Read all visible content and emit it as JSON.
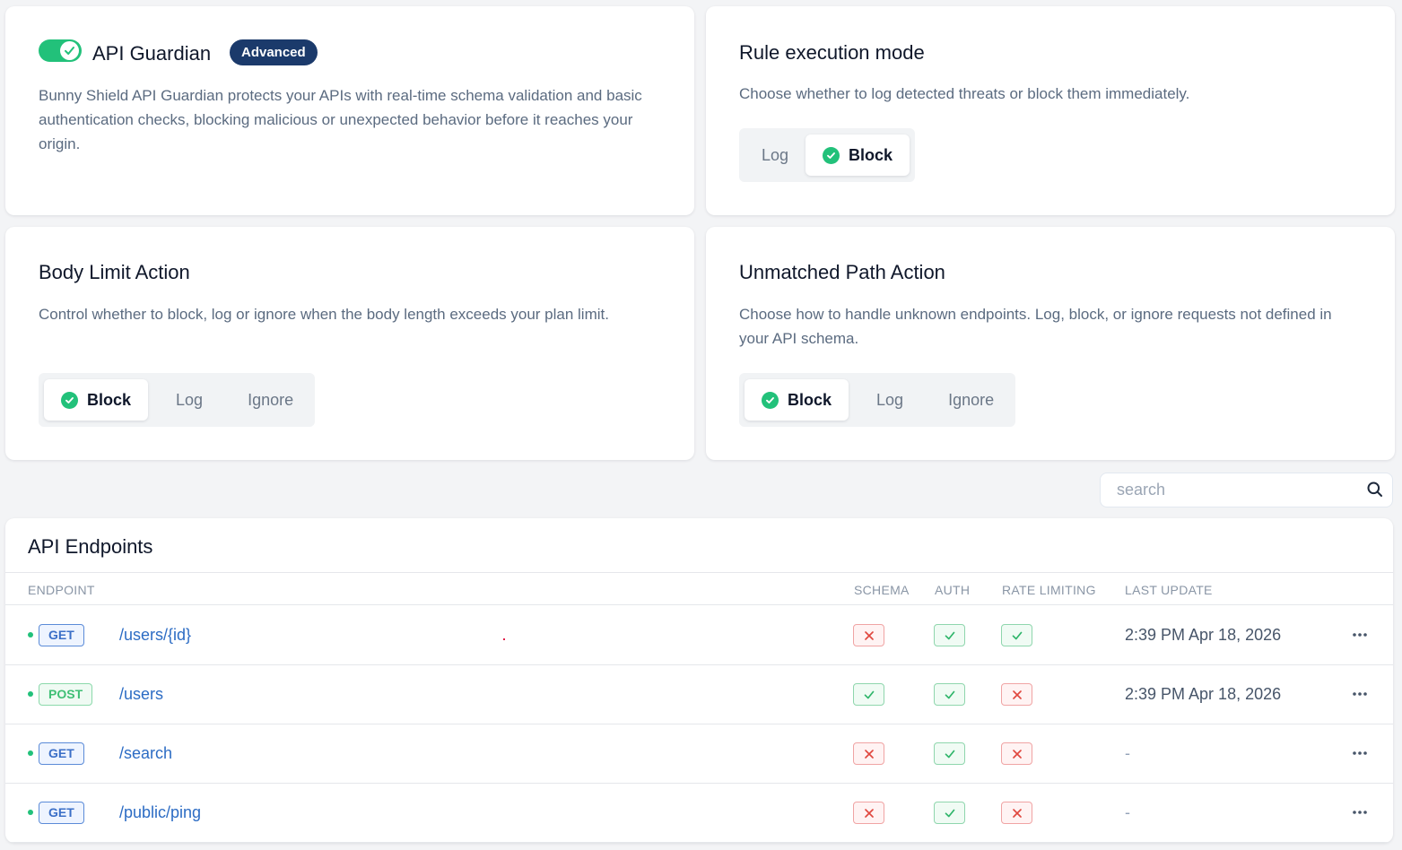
{
  "colors": {
    "accent_green": "#22c17a",
    "badge_navy": "#1b3a6b",
    "link_blue": "#2c6cc4",
    "error_red": "#e0483f"
  },
  "guardian": {
    "toggle_on": true,
    "title": "API Guardian",
    "badge": "Advanced",
    "description": "Bunny Shield API Guardian protects your APIs with real-time schema validation and basic authentication checks, blocking malicious or unexpected behavior before it reaches your origin."
  },
  "execution_mode": {
    "title": "Rule execution mode",
    "description": "Choose whether to log detected threats or block them immediately.",
    "options": [
      "Log",
      "Block"
    ],
    "selected": "Block"
  },
  "body_limit": {
    "title": "Body Limit Action",
    "description": "Control whether to block, log or ignore when the body length exceeds your plan limit.",
    "options": [
      "Block",
      "Log",
      "Ignore"
    ],
    "selected": "Block"
  },
  "unmatched_path": {
    "title": "Unmatched Path Action",
    "description": "Choose how to handle unknown endpoints. Log, block, or ignore requests not defined in your API schema.",
    "options": [
      "Block",
      "Log",
      "Ignore"
    ],
    "selected": "Block"
  },
  "search": {
    "placeholder": "search",
    "icon": "search-icon"
  },
  "endpoints": {
    "title": "API Endpoints",
    "columns": {
      "endpoint": "ENDPOINT",
      "schema": "SCHEMA",
      "auth": "AUTH",
      "rate": "RATE LIMITING",
      "last": "LAST UPDATE"
    },
    "rows": [
      {
        "method": "GET",
        "path": "/users/{id}",
        "schema": false,
        "auth": true,
        "rate": true,
        "last": "2:39 PM Apr 18, 2026"
      },
      {
        "method": "POST",
        "path": "/users",
        "schema": true,
        "auth": true,
        "rate": false,
        "last": "2:39 PM Apr 18, 2026"
      },
      {
        "method": "GET",
        "path": "/search",
        "schema": false,
        "auth": true,
        "rate": false,
        "last": "-"
      },
      {
        "method": "GET",
        "path": "/public/ping",
        "schema": false,
        "auth": true,
        "rate": false,
        "last": "-"
      }
    ]
  }
}
